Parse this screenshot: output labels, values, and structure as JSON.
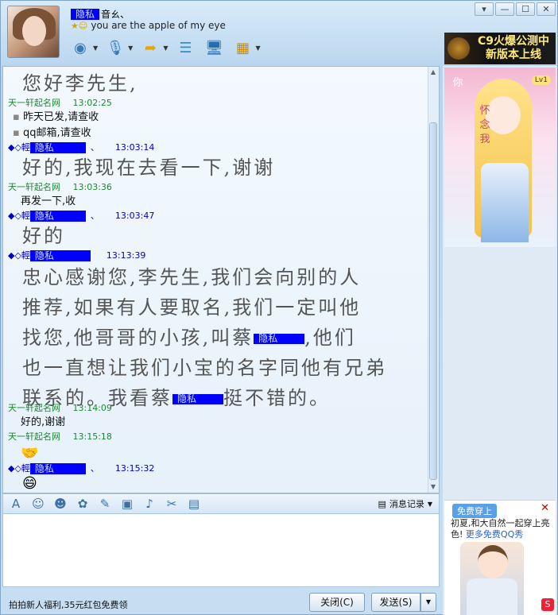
{
  "window": {
    "controls": [
      "▾",
      "—",
      "☐",
      "✕"
    ]
  },
  "contact": {
    "name_masked": "隐私",
    "name_suffix": "音ㄠ、",
    "signature": "you are the apple of my eye"
  },
  "toolbar": {
    "tools": [
      "video-call",
      "voice-call",
      "send-file",
      "create-discussion",
      "remote-assistance",
      "apps"
    ]
  },
  "ad_top": {
    "line1": "C9火爆公测中",
    "line2": "新版本上线"
  },
  "chat": {
    "messages": [
      {
        "type": "text-big",
        "text": "您好李先生,"
      },
      {
        "type": "sender-me",
        "name": "天一轩起名网",
        "time": "13:02:25"
      },
      {
        "type": "text-small",
        "text": "昨天已发,请查收"
      },
      {
        "type": "text-small",
        "text": "qq邮箱,请查收"
      },
      {
        "type": "sender-other",
        "prefix": "◆◇輕",
        "masked": "隐私",
        "suffix": "、",
        "time": "13:03:14"
      },
      {
        "type": "text-big",
        "text": "好的,我现在去看一下,谢谢"
      },
      {
        "type": "sender-me",
        "name": "天一轩起名网",
        "time": "13:03:36"
      },
      {
        "type": "text-small",
        "text": "再发一下,收"
      },
      {
        "type": "sender-other",
        "prefix": "◆◇輕",
        "masked": "隐私",
        "suffix": "、",
        "time": "13:03:47"
      },
      {
        "type": "text-big",
        "text": "好的"
      },
      {
        "type": "sender-other",
        "prefix": "◆◇輕",
        "masked": "隐私",
        "suffix": "",
        "time": "13:13:39"
      },
      {
        "type": "text-big",
        "text": "忠心感谢您,李先生,我们会向别的人"
      },
      {
        "type": "text-big",
        "text": "推荐,如果有人要取名,我们一定叫他"
      },
      {
        "type": "text-big",
        "text": "找您,他哥哥的小孩,叫蔡",
        "masked": "隐私",
        "after": ",他们"
      },
      {
        "type": "text-big",
        "text": "也一直想让我们小宝的名字同他有兄弟"
      },
      {
        "type": "text-big",
        "text": "联系的。我看蔡",
        "masked": "隐私",
        "after": "挺不错的。"
      },
      {
        "type": "sender-me",
        "name": "天一轩起名网",
        "time": "13:14:09"
      },
      {
        "type": "text-small",
        "text": "好的,谢谢"
      },
      {
        "type": "sender-me",
        "name": "天一轩起名网",
        "time": "13:15:18"
      },
      {
        "type": "sender-other",
        "prefix": "◆◇輕",
        "masked": "隐私",
        "suffix": "、",
        "time": "13:15:32"
      }
    ]
  },
  "input_tools": {
    "history_label": "消息记录"
  },
  "bottom": {
    "promo": "拍拍新人福利,35元红包免费领",
    "close_label": "关闭(C)",
    "send_label": "发送(S)"
  },
  "right": {
    "show_text_1": "你",
    "show_text_2": "怀念我",
    "lv": "Lv1",
    "ad_badge": "免费穿上",
    "ad_text": "初夏,和大自然一起穿上亮色!",
    "ad_link": "更多免费QQ秀"
  },
  "colors": {
    "sender_me": "#1a8a2e",
    "sender_other": "#0000c8",
    "mask": "#0000ff"
  }
}
